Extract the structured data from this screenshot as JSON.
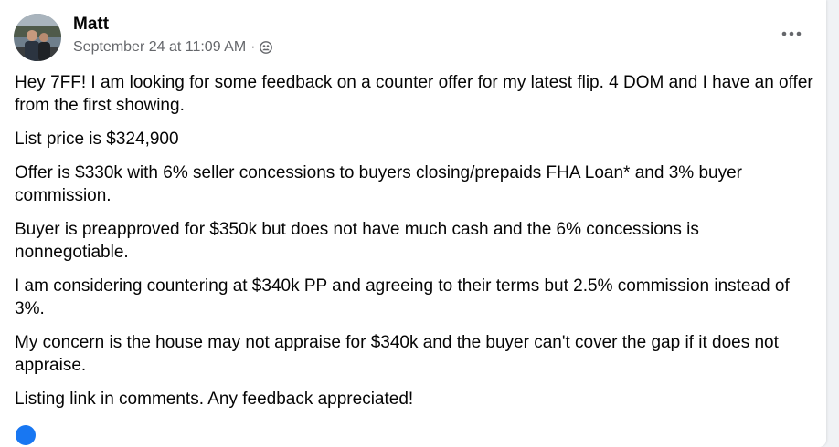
{
  "post": {
    "author": "Matt",
    "timestamp": "September 24 at 11:09 AM",
    "separator": "·",
    "audience_icon": "group-members-icon",
    "more_icon": "more-horizontal-icon",
    "paragraphs": [
      "Hey 7FF! I am looking for some feedback on a counter offer for my latest flip. 4 DOM and I have an offer from the first showing.",
      "List price is $324,900",
      "Offer is $330k with 6% seller concessions to buyers closing/prepaids FHA Loan* and 3% buyer commission.",
      "Buyer is preapproved for $350k but does not have much cash and the 6% concessions is nonnegotiable.",
      "I am considering countering at $340k PP and agreeing to their terms but 2.5% commission instead of 3%.",
      "My concern is the house may not appraise for $340k and the buyer can't cover the gap if it does not appraise.",
      "Listing link in comments. Any feedback appreciated!"
    ]
  },
  "colors": {
    "text_primary": "#050505",
    "text_secondary": "#65676b",
    "accent": "#1877f2",
    "background": "#f0f2f5",
    "card": "#ffffff"
  }
}
